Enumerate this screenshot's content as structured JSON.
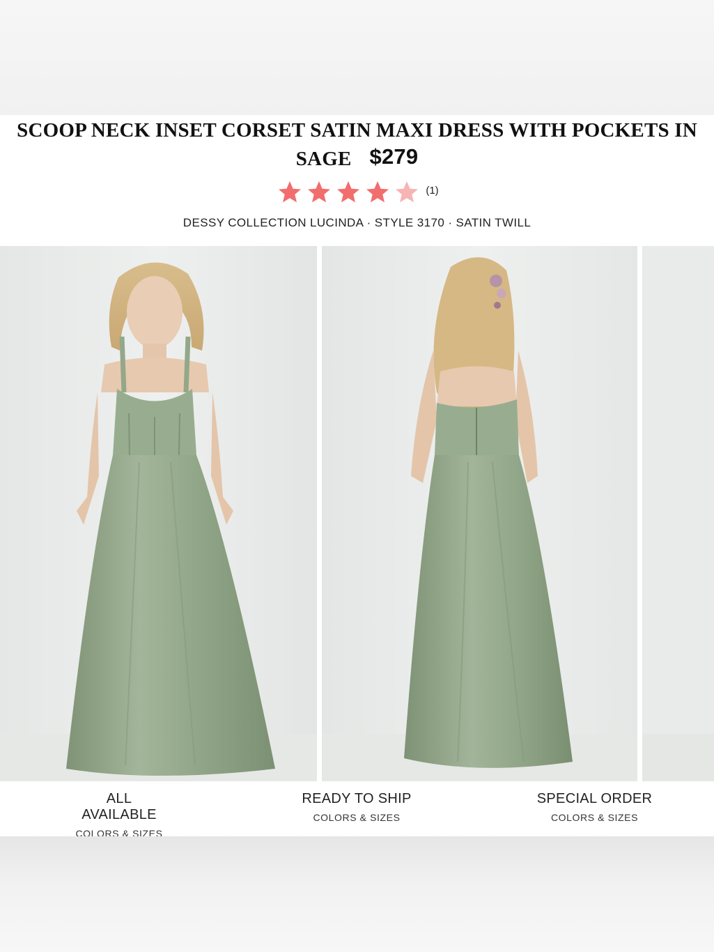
{
  "product": {
    "title": "SCOOP NECK INSET CORSET SATIN MAXI DRESS WITH POCKETS IN SAGE",
    "price": "$279",
    "rating": 4.5,
    "rating_max": 5,
    "review_count": "(1)",
    "meta": "DESSY COLLECTION LUCINDA · STYLE 3170 · SATIN TWILL",
    "dress_color": "#93a88a",
    "star_color": "#f26d6d",
    "star_empty_color": "#f7b4b4"
  },
  "gallery": {
    "images": [
      {
        "name": "front-view",
        "alt": "front view"
      },
      {
        "name": "back-view",
        "alt": "back view"
      },
      {
        "name": "next-view",
        "alt": "next view"
      }
    ]
  },
  "tabs": [
    {
      "title": "ALL AVAILABLE",
      "subtitle": "COLORS & SIZES",
      "active": true
    },
    {
      "title": "READY TO SHIP",
      "subtitle": "COLORS & SIZES",
      "active": false
    },
    {
      "title": "SPECIAL ORDER",
      "subtitle": "COLORS & SIZES",
      "active": false
    }
  ]
}
